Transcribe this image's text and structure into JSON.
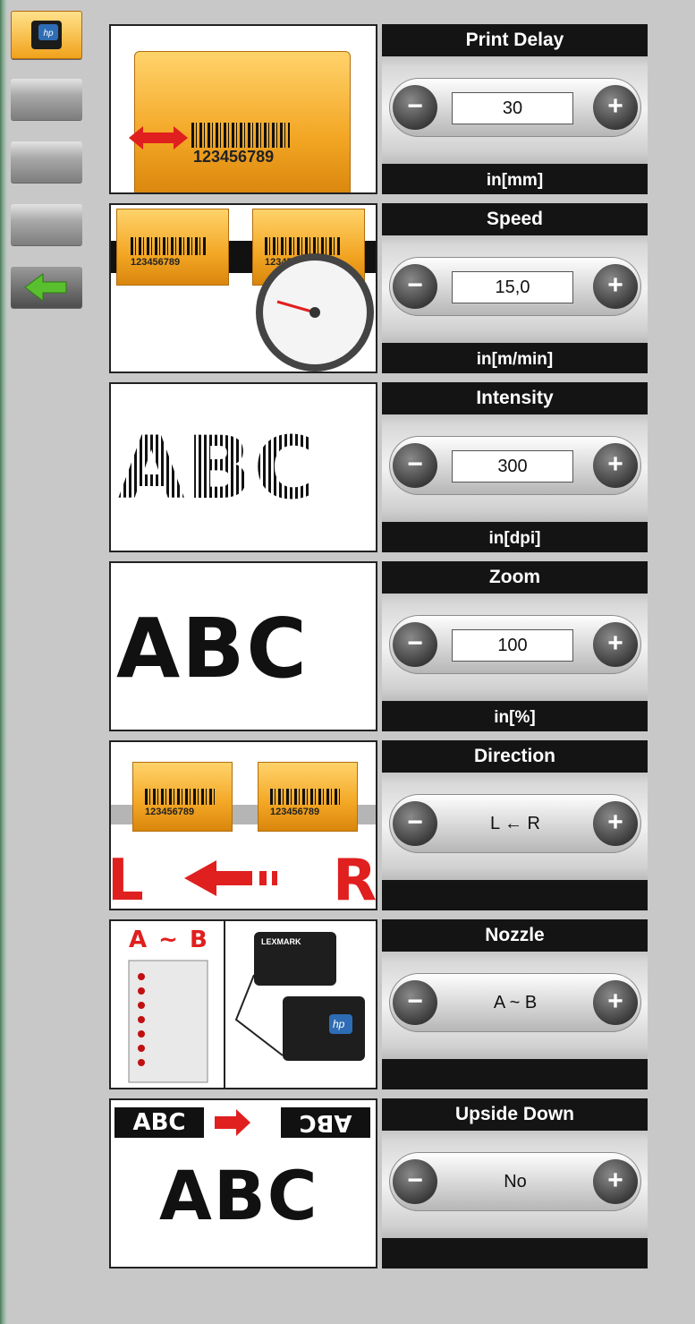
{
  "sidebar": {
    "items": [
      {
        "name": "printer-tab",
        "icon": "hp-printer-icon"
      },
      {
        "name": "blank-tab-1"
      },
      {
        "name": "blank-tab-2"
      },
      {
        "name": "blank-tab-3"
      },
      {
        "name": "back-button",
        "icon": "arrow-left-icon",
        "icon_color": "#5abf2e"
      }
    ]
  },
  "settings": [
    {
      "title": "Print Delay",
      "value": "30",
      "unit": "in[mm]",
      "control": "input"
    },
    {
      "title": "Speed",
      "value": "15,0",
      "unit": "in[m/min]",
      "control": "input"
    },
    {
      "title": "Intensity",
      "value": "300",
      "unit": "in[dpi]",
      "control": "input"
    },
    {
      "title": "Zoom",
      "value": "100",
      "unit": "in[%]",
      "control": "input"
    },
    {
      "title": "Direction",
      "value": "L ← R",
      "unit": "",
      "control": "text"
    },
    {
      "title": "Nozzle",
      "value": "A ~ B",
      "unit": "",
      "control": "text"
    },
    {
      "title": "Upside Down",
      "value": "No",
      "unit": "",
      "control": "text"
    }
  ],
  "illustrations": {
    "print_delay": {
      "barcode_number": "123456789"
    },
    "speed": {
      "barcode_number_1": "123456789",
      "barcode_number_2": "123456789"
    },
    "intensity": {
      "text": "ABC"
    },
    "zoom": {
      "text": "ABC"
    },
    "direction": {
      "barcode_number_1": "123456789",
      "barcode_number_2": "123456789",
      "left_letter": "L",
      "right_letter": "R"
    },
    "nozzle": {
      "label": "A ~ B",
      "cartridge_brand_1": "LEXMARK",
      "cartridge_brand_2": "hp"
    },
    "upside_down": {
      "normal_label": "ABC",
      "flipped_label": "ABC",
      "big_text": "ABC"
    }
  },
  "colors": {
    "background": "#c8c8c8",
    "panel_header": "#141414",
    "accent_orange": "#f3a624",
    "arrow_red": "#e01f1f"
  }
}
